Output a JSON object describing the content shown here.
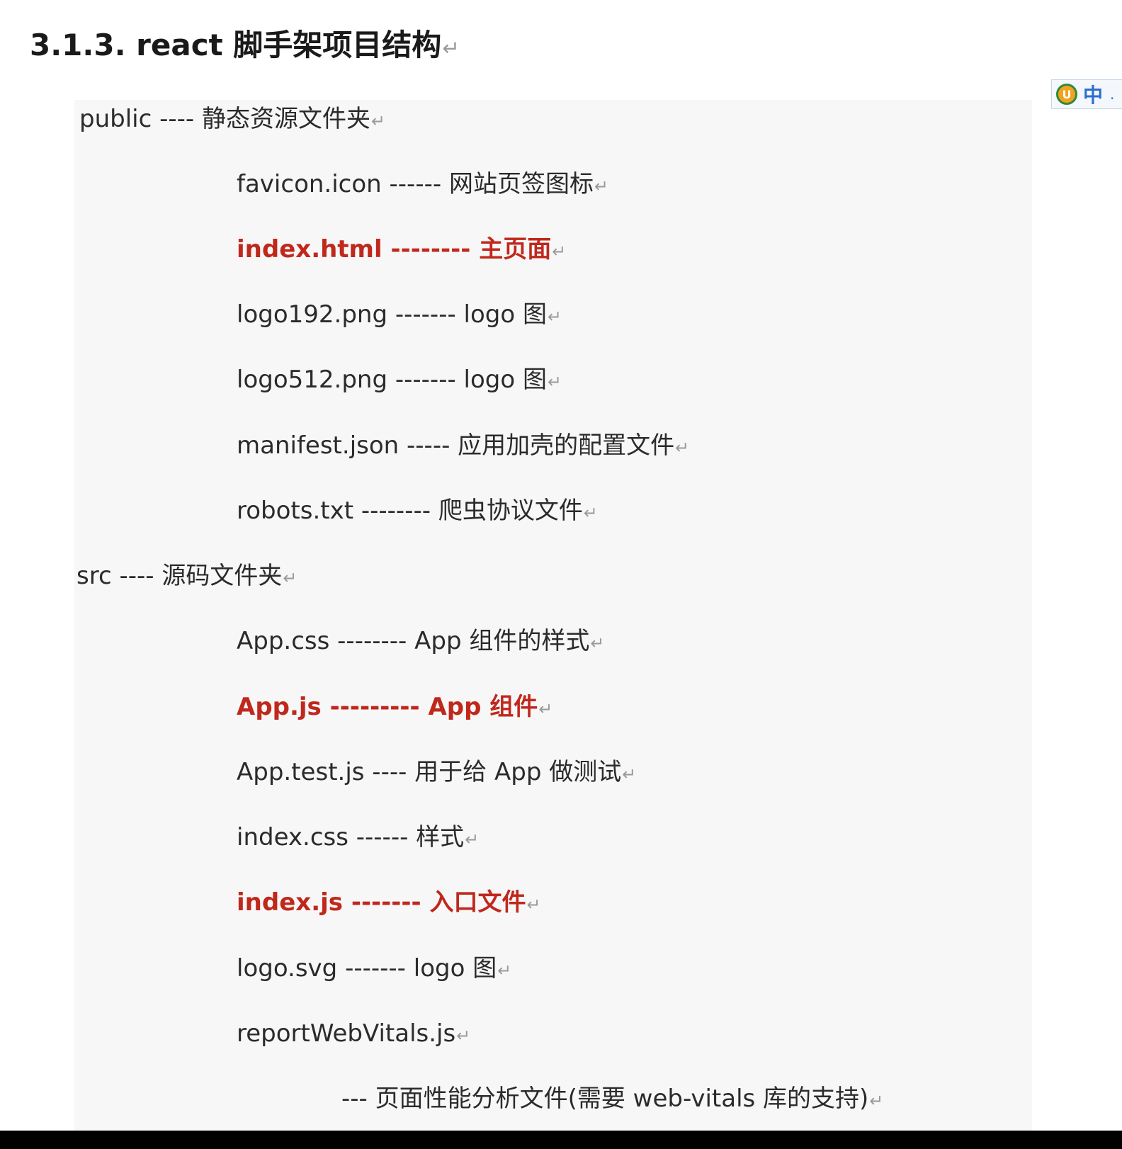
{
  "heading": {
    "text": "3.1.3. react 脚手架项目结构",
    "pilcrow": "↵"
  },
  "ime": {
    "logo": "U",
    "lang": "中",
    "extra": "."
  },
  "lines": [
    {
      "text": "public ---- 静态资源文件夹",
      "pilcrow": "↵",
      "highlight": false
    },
    {
      "text": "favicon.icon ------ 网站页签图标",
      "pilcrow": "↵",
      "highlight": false
    },
    {
      "text": "index.html -------- 主页面",
      "pilcrow": "↵",
      "highlight": true
    },
    {
      "text": "logo192.png ------- logo 图",
      "pilcrow": "↵",
      "highlight": false
    },
    {
      "text": "logo512.png ------- logo 图",
      "pilcrow": "↵",
      "highlight": false
    },
    {
      "text": "manifest.json ----- 应用加壳的配置文件",
      "pilcrow": "↵",
      "highlight": false
    },
    {
      "text": "robots.txt -------- 爬虫协议文件",
      "pilcrow": "↵",
      "highlight": false
    },
    {
      "text": "src ---- 源码文件夹",
      "pilcrow": "↵",
      "highlight": false
    },
    {
      "text": "App.css -------- App 组件的样式",
      "pilcrow": "↵",
      "highlight": false
    },
    {
      "text": "App.js --------- App 组件",
      "pilcrow": "↵",
      "highlight": true
    },
    {
      "text": "App.test.js ---- 用于给 App 做测试",
      "pilcrow": "↵",
      "highlight": false
    },
    {
      "text": "index.css ------ 样式",
      "pilcrow": "↵",
      "highlight": false
    },
    {
      "text": "index.js ------- 入口文件",
      "pilcrow": "↵",
      "highlight": true
    },
    {
      "text": "logo.svg ------- logo 图",
      "pilcrow": "↵",
      "highlight": false
    },
    {
      "text": "reportWebVitals.js",
      "pilcrow": "↵",
      "highlight": false
    },
    {
      "text": "--- 页面性能分析文件(需要 web-vitals 库的支持)",
      "pilcrow": "↵",
      "highlight": false
    }
  ]
}
